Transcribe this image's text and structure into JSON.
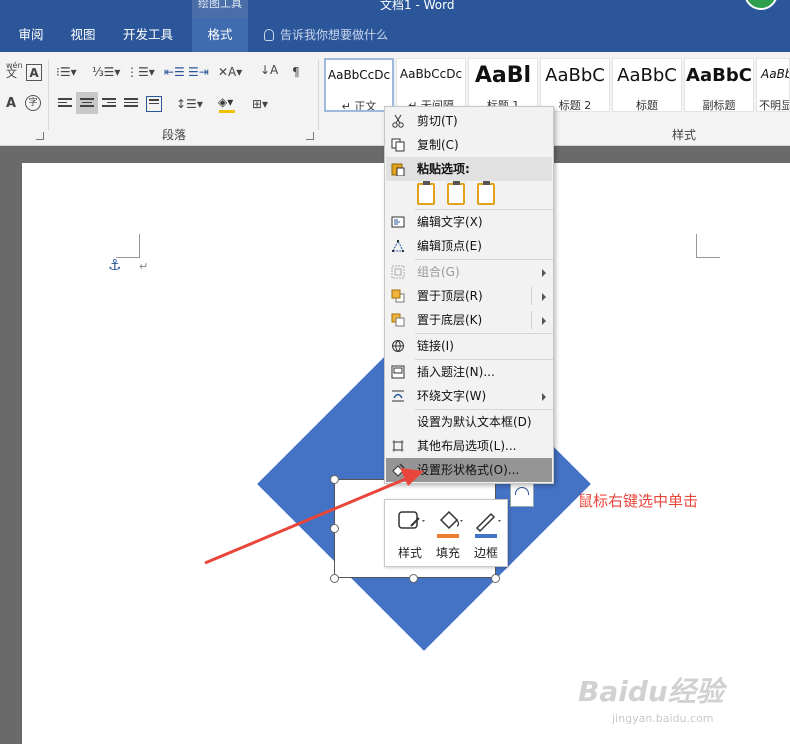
{
  "titlebar": {
    "context_tab": "绘图工具",
    "doc_title": "文档1 - Word"
  },
  "tabs": [
    {
      "label": "审阅"
    },
    {
      "label": "视图"
    },
    {
      "label": "开发工具"
    },
    {
      "label": "格式",
      "active": true
    }
  ],
  "tellme": {
    "placeholder": "告诉我你想要做什么"
  },
  "ribbon": {
    "groups": {
      "paragraph": "段落",
      "styles": "样式"
    },
    "styles_gallery": [
      {
        "sample": "AaBbCcDc",
        "name": "↵ 正文",
        "selected": true
      },
      {
        "sample": "AaBbCcDc",
        "name": "↵ 无间隔"
      },
      {
        "sample": "AaBl",
        "name": "标题 1"
      },
      {
        "sample": "AaBbC",
        "name": "标题 2"
      },
      {
        "sample": "AaBbC",
        "name": "标题"
      },
      {
        "sample": "AaBbC",
        "name": "副标题"
      },
      {
        "sample": "AaBbC",
        "name": "不明显"
      }
    ],
    "font_glyphs": {
      "phonetic": "wén",
      "phonetic_sub": "文",
      "A_box": "A",
      "A_plain": "A",
      "A_circle": "字"
    }
  },
  "document": {
    "anchor_glyph": "⚓",
    "paragraph_mark": "↵"
  },
  "context_menu": {
    "items": [
      {
        "label": "剪切(T)",
        "icon": "scissors-icon"
      },
      {
        "label": "复制(C)",
        "icon": "copy-icon"
      },
      {
        "label": "粘贴选项:",
        "icon": "clipboard-icon",
        "header": true
      },
      {
        "label": "编辑文字(X)",
        "icon": "edit-text-icon"
      },
      {
        "label": "编辑顶点(E)",
        "icon": "edit-points-icon"
      },
      {
        "label": "组合(G)",
        "icon": "group-icon",
        "disabled": true,
        "submenu": true
      },
      {
        "label": "置于顶层(R)",
        "icon": "bring-front-icon",
        "submenu": true
      },
      {
        "label": "置于底层(K)",
        "icon": "send-back-icon",
        "submenu": true
      },
      {
        "label": "链接(I)",
        "icon": "link-icon"
      },
      {
        "label": "插入题注(N)...",
        "icon": "caption-icon"
      },
      {
        "label": "环绕文字(W)",
        "icon": "wrap-text-icon",
        "submenu": true
      },
      {
        "label": "设置为默认文本框(D)",
        "icon": ""
      },
      {
        "label": "其他布局选项(L)...",
        "icon": "layout-options-icon"
      },
      {
        "label": "设置形状格式(O)...",
        "icon": "format-shape-icon",
        "highlight": true
      }
    ]
  },
  "mini_toolbar": {
    "style_label": "样式",
    "fill_label": "填充",
    "border_label": "边框"
  },
  "annotation": {
    "text": "鼠标右键选中单击"
  },
  "watermark": {
    "brand": "Baidu经验",
    "url": "jingyan.baidu.com"
  },
  "colors": {
    "word_blue": "#2b579a",
    "shape_fill": "#4472c4",
    "annotation_red": "#e8463b",
    "fill_accent": "#ed7d31",
    "border_accent": "#4472c4"
  }
}
